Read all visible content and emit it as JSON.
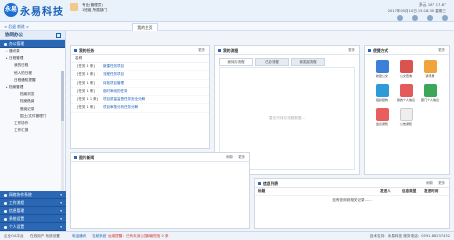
{
  "header": {
    "logo_text": "永易",
    "brand": "永易科技",
    "user_line1": "专业(管理员)",
    "user_line2": "1班组   所属部门",
    "weather": "多云  18° 17.8°",
    "datetime": "2017年05月10日  15:18:30 星期三",
    "icons": [
      "home-icon",
      "refresh-icon",
      "settings-icon",
      "power-icon"
    ]
  },
  "nav": {
    "back_label": "< 后退 前进 >",
    "home_tab": "我的主页"
  },
  "sidebar": {
    "title": "协同办公",
    "group_top": "办公管理",
    "items": [
      {
        "label": "通讯录",
        "level": 1
      },
      {
        "label": "日程管理",
        "level": 1
      },
      {
        "label": "我的日程",
        "level": 2
      },
      {
        "label": "他人的日程",
        "level": 2
      },
      {
        "label": "日程通知提醒",
        "level": 2
      },
      {
        "label": "档案管理",
        "level": 1
      },
      {
        "label": "档案浏览",
        "level": 2
      },
      {
        "label": "档案借阅",
        "level": 2
      },
      {
        "label": "借阅记录",
        "level": 2
      },
      {
        "label": "国土/文件管理门",
        "level": 2
      },
      {
        "label": "工作协作",
        "level": 1
      },
      {
        "label": "工作汇报",
        "level": 1
      }
    ],
    "bottom_groups": [
      "网络协作系统",
      "工作流程",
      "信息管理",
      "系统设置",
      "个人设置"
    ]
  },
  "tasks": {
    "title": "我的任务",
    "more": "更多",
    "header": "名称",
    "rows": [
      {
        "tag": "[任务 1 条]",
        "text": "新建任务项目"
      },
      {
        "tag": "[任务 1 条]",
        "text": "流程任务项目"
      },
      {
        "tag": "[任务 1 条]",
        "text": "待批项目管理"
      },
      {
        "tag": "[任务 1 条]",
        "text": "临时审阅的任务"
      },
      {
        "tag": "[任务 1 1 条]",
        "text": "项目质量监督任务安全分解"
      },
      {
        "tag": "[任务 1 条]",
        "text": "项目审核分析任务分解"
      }
    ]
  },
  "flow": {
    "title": "我的流程",
    "more": "更多",
    "tabs": [
      "我待办流程",
      "已办流程",
      "我发起流程"
    ],
    "empty": "暂无可待办流程数据..."
  },
  "shortcuts": {
    "title": "便捷方式",
    "more": "更多",
    "apps": [
      {
        "label": "新建公文",
        "icon": "doc-new-icon",
        "color": "#3b7fd6"
      },
      {
        "label": "公文查询",
        "icon": "doc-search-icon",
        "color": "#d9534f"
      },
      {
        "label": "通讯录",
        "icon": "address-book-icon",
        "color": "#f0a53c"
      },
      {
        "label": "组织结构",
        "icon": "org-chart-icon",
        "color": "#2f9ad8"
      },
      {
        "label": "我的个人信息",
        "icon": "profile-icon",
        "color": "#e25a5a"
      },
      {
        "label": "部门个人信息",
        "icon": "department-icon",
        "color": "#3aa856"
      },
      {
        "label": "会议通知",
        "icon": "meeting-icon",
        "color": "#e85d5d"
      },
      {
        "label": "公告通知",
        "icon": "notice-icon",
        "color": "#eeeeee"
      }
    ]
  },
  "news": {
    "title": "图片新闻",
    "more": "更多",
    "refresh": "刷新"
  },
  "mail": {
    "title": "信息列表",
    "more": "更多",
    "refresh": "刷新",
    "columns": [
      "标题",
      "发送人",
      "信息类型",
      "发送时间"
    ],
    "empty": "没有查询到相关记录……"
  },
  "footer": {
    "left": "企业OA平台",
    "mid1": "在线用户  系统设置",
    "link1": "电话通讯",
    "alert_prefix": "当前系统",
    "alert": "运维提醒：已有未读公告 0",
    "count": "未读短信 0 条",
    "right": "技术支持：永易科技    服务电话：0591-88237432"
  }
}
